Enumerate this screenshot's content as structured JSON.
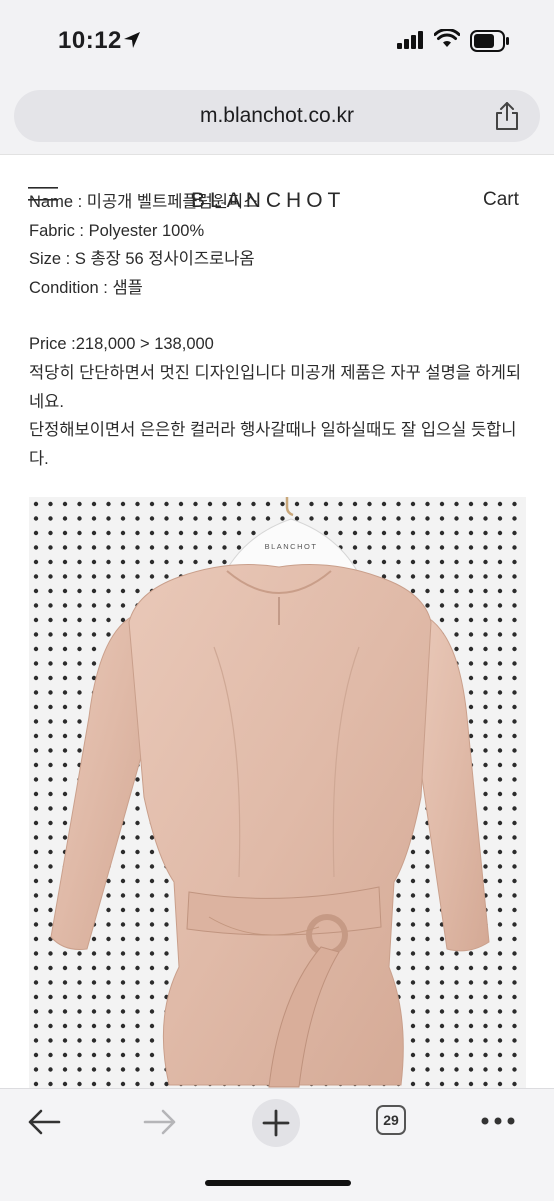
{
  "status_bar": {
    "time": "10:12"
  },
  "browser": {
    "url": "m.blanchot.co.kr",
    "tab_count": "29"
  },
  "site": {
    "logo": "BLANCHOT",
    "cart": "Cart"
  },
  "product": {
    "name_line": "Name : 미공개 벨트페플럼원피스",
    "fabric_line": "Fabric : Polyester 100%",
    "size_line": "Size :  S 총장 56 정사이즈로나옴",
    "condition_line": "Condition : 샘플",
    "price_line": "Price :218,000 > 138,000",
    "desc_1": "적당히 단단하면서 멋진 디자인입니다 미공개 제품은 자꾸 설명을 하게되네요.",
    "desc_2": "단정해보이면서 은은한 컬러라 행사갈때나 일하실때도 잘 입으실 듯합니다.",
    "hanger_label": "BLANCHOT"
  },
  "colors": {
    "chrome_bg": "#f2f2f4",
    "url_bar": "#e4e4e8",
    "garment": "#e3bfae",
    "pegboard": "#f1f1f1"
  },
  "icons": {
    "back": "arrow-left-icon",
    "forward": "arrow-right-icon",
    "new_tab": "plus-icon",
    "tabs": "tabs-icon",
    "more": "more-dots-icon",
    "share": "share-icon",
    "menu": "hamburger-menu-icon"
  }
}
